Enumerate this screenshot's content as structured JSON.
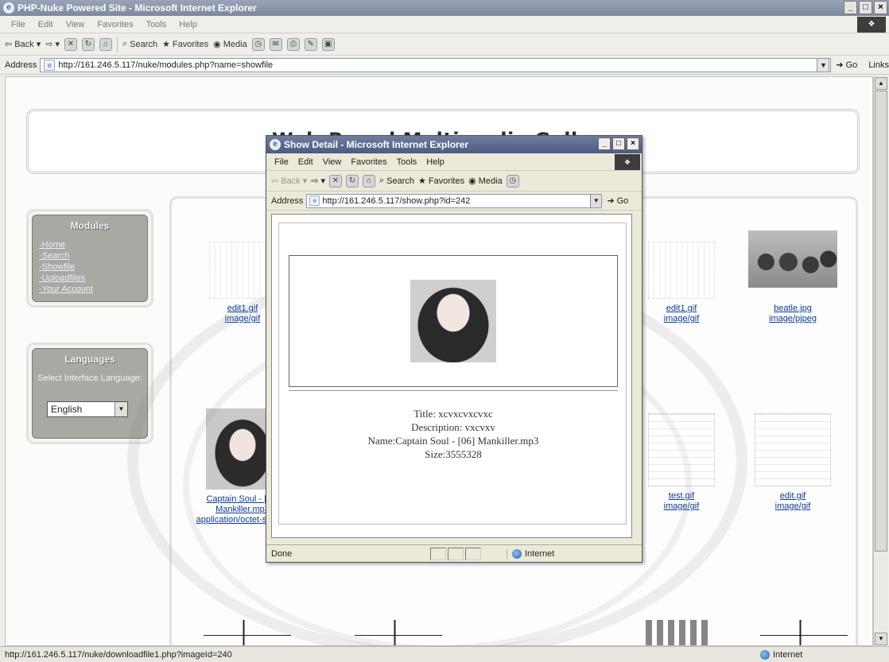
{
  "main_window": {
    "title": "PHP-Nuke Powered Site - Microsoft Internet Explorer",
    "menu": [
      "File",
      "Edit",
      "View",
      "Favorites",
      "Tools",
      "Help"
    ],
    "toolbar": {
      "back": "Back",
      "search": "Search",
      "favorites": "Favorites",
      "media": "Media"
    },
    "address_label": "Address",
    "address_url": "http://161.246.5.117/nuke/modules.php?name=showfile",
    "go_label": "Go",
    "links_label": "Links"
  },
  "page": {
    "site_title": "Web-Based Multimedia Gallery",
    "modules": {
      "title": "Modules",
      "links": [
        "Home",
        "Search",
        "Showfile",
        "Uploadfiles",
        "Your Account"
      ]
    },
    "languages": {
      "title": "Languages",
      "label": "Select Interface Language:",
      "selected": "English"
    },
    "gallery": [
      {
        "name": "edit1.gif",
        "type": "image/gif",
        "style": "img-sparse"
      },
      {
        "name": "edit1.gif",
        "type": "image/gif",
        "style": "img-sparse"
      },
      {
        "name": "beatle.jpg",
        "type": "image/pjpeg",
        "style": "img-beatles"
      },
      {
        "name": "Captain Soul - [06] Mankiller.mp3",
        "type": "application/octet-stream",
        "style": "img-girl"
      },
      {
        "name": "test.gif",
        "type": "image/gif",
        "style": "img-mixed"
      },
      {
        "name": "edit.gif",
        "type": "image/gif",
        "style": "img-mixed"
      }
    ]
  },
  "popup": {
    "title": "Show Detail - Microsoft Internet Explorer",
    "menu": [
      "File",
      "Edit",
      "View",
      "Favorites",
      "Tools",
      "Help"
    ],
    "toolbar": {
      "back": "Back",
      "search": "Search",
      "favorites": "Favorites",
      "media": "Media"
    },
    "address_label": "Address",
    "address_url": "http://161.246.5.117/show.php?id=242",
    "go_label": "Go",
    "detail": {
      "title_line": "Title: xcvxcvxcvxc",
      "description_line": "Description: vxcvxv",
      "name_line": "Name:Captain Soul - [06] Mankiller.mp3",
      "size_line": "Size:3555328"
    },
    "status_text": "Done",
    "zone_text": "Internet"
  },
  "status_bar": {
    "url": "http://161.246.5.117/nuke/downloadfile1.php?imageId=240",
    "zone": "Internet"
  }
}
